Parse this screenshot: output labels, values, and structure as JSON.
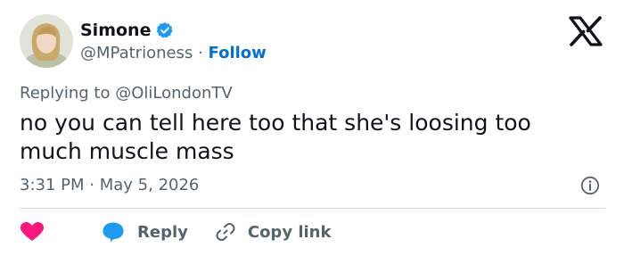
{
  "author": {
    "display_name": "Simone",
    "handle": "@MPatrioness",
    "separator": "·",
    "follow_label": "Follow"
  },
  "reply_to": {
    "prefix": "Replying to",
    "mention": "@OliLondonTV"
  },
  "tweet": {
    "text": "no you can tell here too that she's loosing too much muscle mass",
    "time": "3:31 PM",
    "date_separator": "·",
    "date": "May 5, 2026"
  },
  "actions": {
    "reply_label": "Reply",
    "copy_link_label": "Copy link"
  },
  "icons": {
    "verified": "verified-badge-icon",
    "platform": "x-logo-icon",
    "info": "info-icon",
    "like": "heart-icon",
    "reply": "speech-bubble-icon",
    "copy": "link-icon"
  },
  "colors": {
    "text": "#0f1419",
    "secondary": "#536471",
    "link": "#006fd6",
    "verified": "#1d9bf0",
    "heart": "#f91880",
    "reply_icon": "#1d9bf0",
    "divider": "#cfd9de"
  }
}
